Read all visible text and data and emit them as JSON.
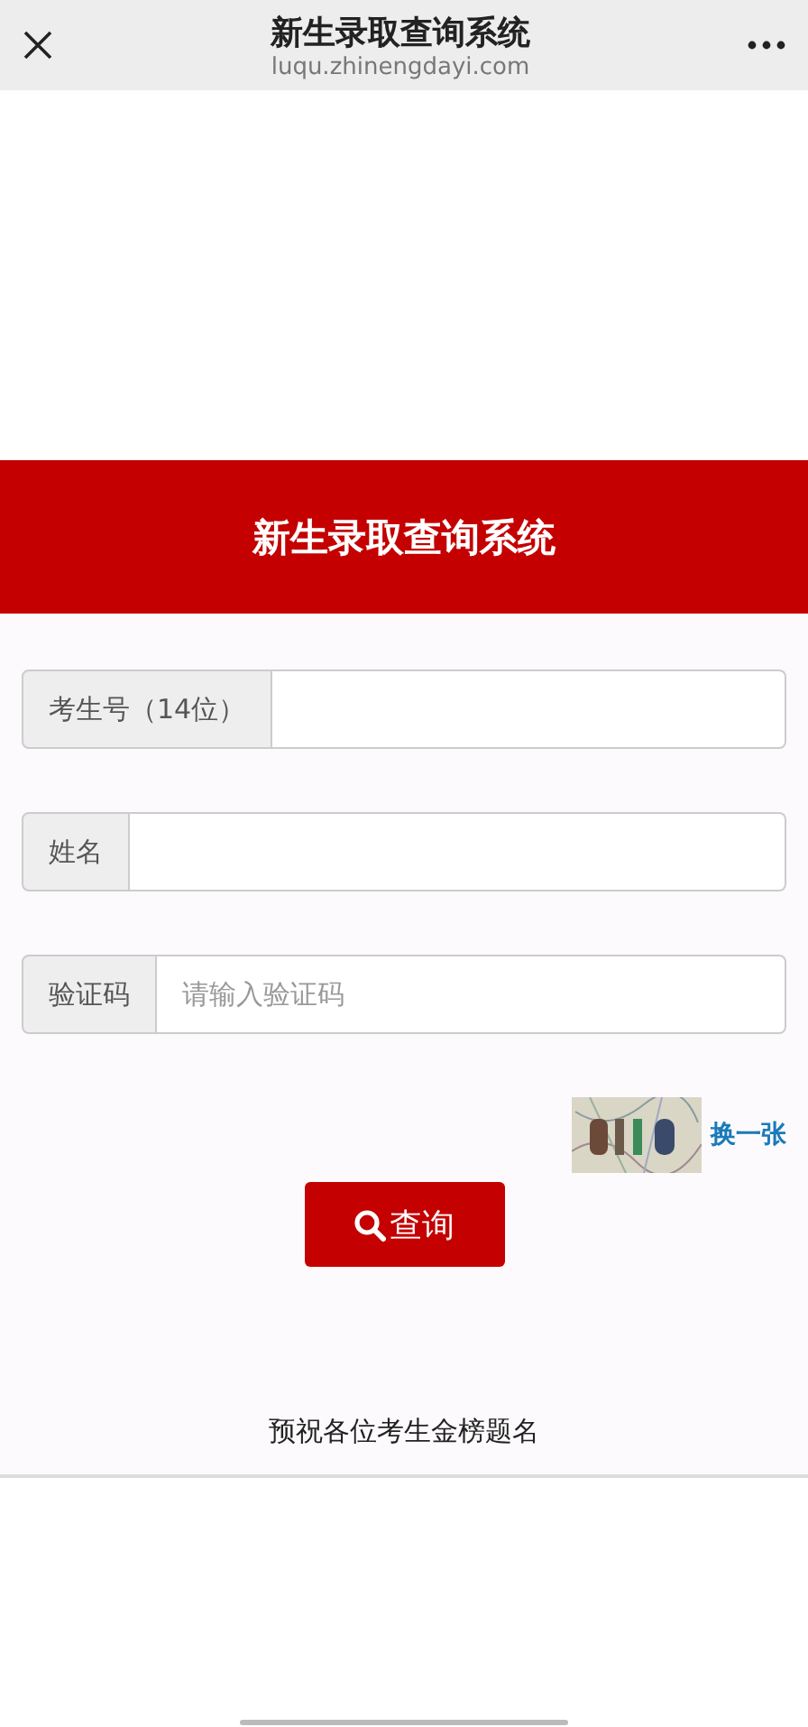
{
  "top_bar": {
    "title": "新生录取查询系统",
    "url": "luqu.zhinengdayi.com"
  },
  "banner": {
    "title": "新生录取查询系统"
  },
  "fields": [
    {
      "label": "考生号（14位）"
    },
    {
      "label": "姓名"
    },
    {
      "label": "验证码",
      "placeholder": "请输入验证码"
    }
  ],
  "captcha": {
    "kind": "picture",
    "refresh_link": "换一张"
  },
  "search_button": "查询",
  "footer_text": "预祝各位考生金榜题名"
}
